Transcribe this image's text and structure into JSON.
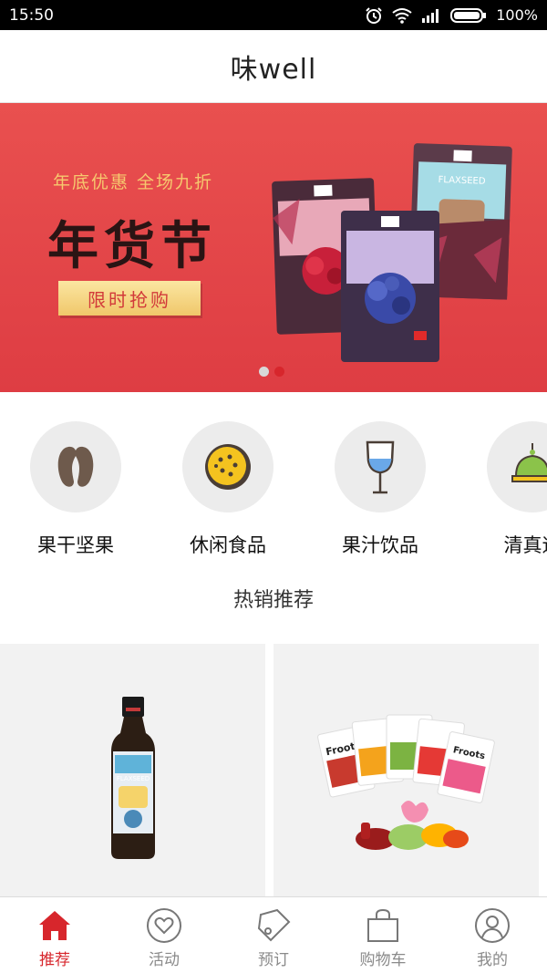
{
  "status_bar": {
    "time": "15:50",
    "battery": "100%"
  },
  "header": {
    "title": "味well"
  },
  "banner": {
    "subtitle": "年底优惠 全场九折",
    "title": "年货节",
    "cta": "限时抢购",
    "slide_count": 2,
    "active_slide": 2
  },
  "categories": [
    {
      "label": "果干坚果",
      "icon": "nuts-icon"
    },
    {
      "label": "休闲食品",
      "icon": "cookie-icon"
    },
    {
      "label": "果汁饮品",
      "icon": "wine-glass-icon"
    },
    {
      "label": "清真速",
      "icon": "mosque-icon"
    }
  ],
  "section": {
    "title": "热销推荐"
  },
  "products": [
    {
      "label": "FLAXSEED"
    },
    {
      "label": "Froots"
    }
  ],
  "bottom_nav": [
    {
      "label": "推荐",
      "icon": "home-icon",
      "active": true
    },
    {
      "label": "活动",
      "icon": "heart-icon",
      "active": false
    },
    {
      "label": "预订",
      "icon": "tag-icon",
      "active": false
    },
    {
      "label": "购物车",
      "icon": "shopping-bag-icon",
      "active": false
    },
    {
      "label": "我的",
      "icon": "user-icon",
      "active": false
    }
  ],
  "colors": {
    "accent": "#d7262c",
    "banner_bg": "#e34a4a",
    "gold": "#f6c86e"
  }
}
